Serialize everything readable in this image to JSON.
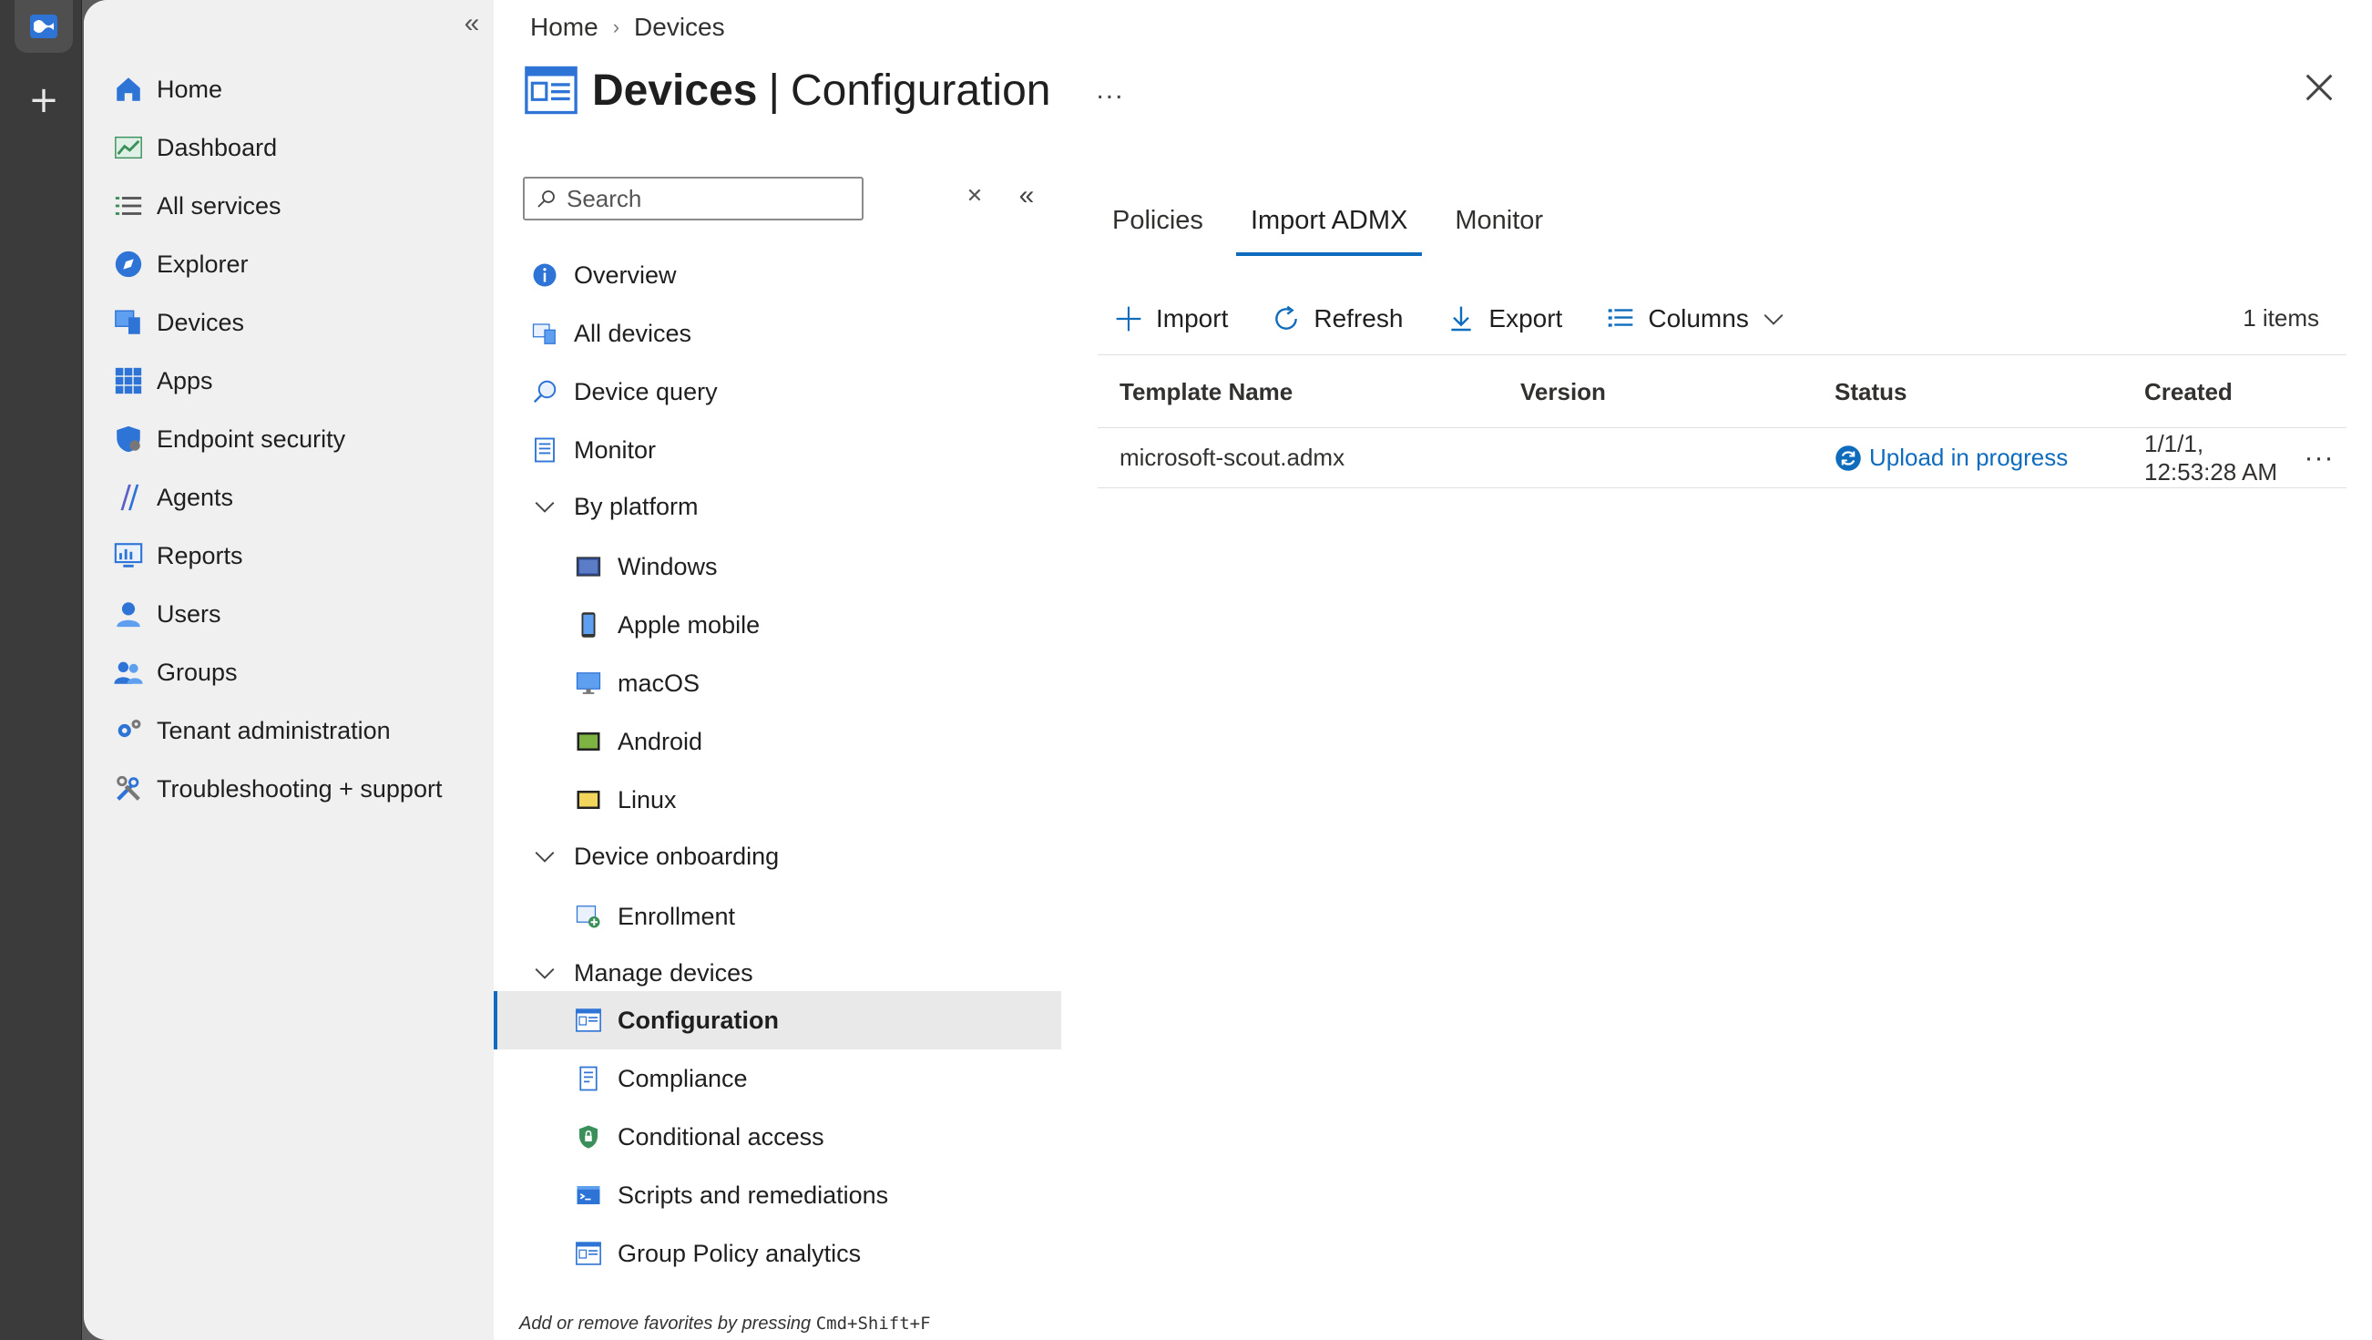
{
  "nav": {
    "items": [
      {
        "label": "Home",
        "icon": "home-icon"
      },
      {
        "label": "Dashboard",
        "icon": "dashboard-icon"
      },
      {
        "label": "All services",
        "icon": "list-icon"
      },
      {
        "label": "Explorer",
        "icon": "explorer-icon"
      },
      {
        "label": "Devices",
        "icon": "devices-icon"
      },
      {
        "label": "Apps",
        "icon": "apps-grid-icon"
      },
      {
        "label": "Endpoint security",
        "icon": "shield-icon"
      },
      {
        "label": "Agents",
        "icon": "agents-icon"
      },
      {
        "label": "Reports",
        "icon": "reports-icon"
      },
      {
        "label": "Users",
        "icon": "user-icon"
      },
      {
        "label": "Groups",
        "icon": "groups-icon"
      },
      {
        "label": "Tenant administration",
        "icon": "gear-icon"
      },
      {
        "label": "Troubleshooting + support",
        "icon": "tools-icon"
      }
    ]
  },
  "breadcrumb": [
    "Home",
    "Devices"
  ],
  "title": {
    "bold": "Devices",
    "separator": "|",
    "rest": "Configuration",
    "more": "..."
  },
  "search": {
    "placeholder": "Search"
  },
  "subnav": {
    "overview": "Overview",
    "all_devices": "All devices",
    "device_query": "Device query",
    "monitor": "Monitor",
    "by_platform": "By platform",
    "windows": "Windows",
    "apple_mobile": "Apple mobile",
    "macos": "macOS",
    "android": "Android",
    "linux": "Linux",
    "device_onboarding": "Device onboarding",
    "enrollment": "Enrollment",
    "manage_devices": "Manage devices",
    "configuration": "Configuration",
    "compliance": "Compliance",
    "conditional_access": "Conditional access",
    "scripts": "Scripts and remediations",
    "gp_analytics": "Group Policy analytics"
  },
  "fav_hint": {
    "text": "Add or remove favorites by pressing ",
    "keys": "Cmd+Shift+F"
  },
  "tabs": [
    "Policies",
    "Import ADMX",
    "Monitor"
  ],
  "active_tab": "Import ADMX",
  "toolbar": {
    "import": "Import",
    "refresh": "Refresh",
    "export": "Export",
    "columns": "Columns",
    "count": "1 items"
  },
  "grid": {
    "headers": [
      "Template Name",
      "Version",
      "Status",
      "Created"
    ],
    "rows": [
      {
        "name": "microsoft-scout.admx",
        "version": "",
        "status": "Upload in progress",
        "created": "1/1/1, 12:53:28 AM",
        "more": "···"
      }
    ]
  },
  "colors": {
    "accent": "#0f6cbd",
    "nav_bg": "#f0f0f0"
  }
}
